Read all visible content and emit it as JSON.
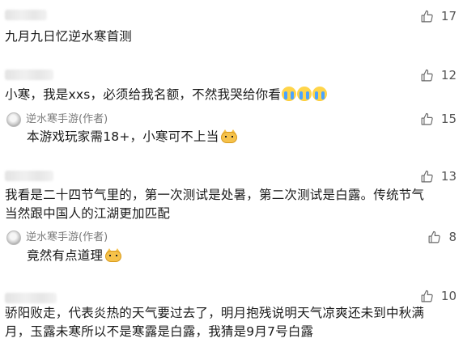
{
  "comments": [
    {
      "text": "九月九日忆逆水寒首测",
      "likes": "17",
      "emoji": ""
    },
    {
      "text": "小寒，我是xxs，必须给我名额，不然我哭给你看",
      "likes": "12",
      "emoji": "crying-face x3"
    },
    {
      "author": "逆水寒手游(作者)",
      "text": "本游戏玩家需18+，小寒可不上当",
      "likes": "15",
      "emoji": "cat-face"
    },
    {
      "text_line1": "我看是二十四节气里的，第一次测试是处暑，第二次测试是白露。传统节气",
      "text_line2": "当然跟中国人的江湖更加匹配",
      "likes": "13",
      "emoji": ""
    },
    {
      "author": "逆水寒手游(作者)",
      "text": "竟然有点道理",
      "likes": "8",
      "emoji": "cat-face"
    },
    {
      "text_line1": "骄阳败走，代表炎热的天气要过去了，明月抱残说明天气凉爽还未到中秋满",
      "text_line2": "月，玉露未寒所以不是寒露是白露，我猜是9月7号白露",
      "likes": "10",
      "emoji": ""
    }
  ],
  "icons": {
    "like": "thumbs-up-icon",
    "avatar": "author-avatar"
  },
  "colors": {
    "text": "#1a1a1a",
    "meta": "#7a7a7a",
    "background": "#ffffff"
  }
}
